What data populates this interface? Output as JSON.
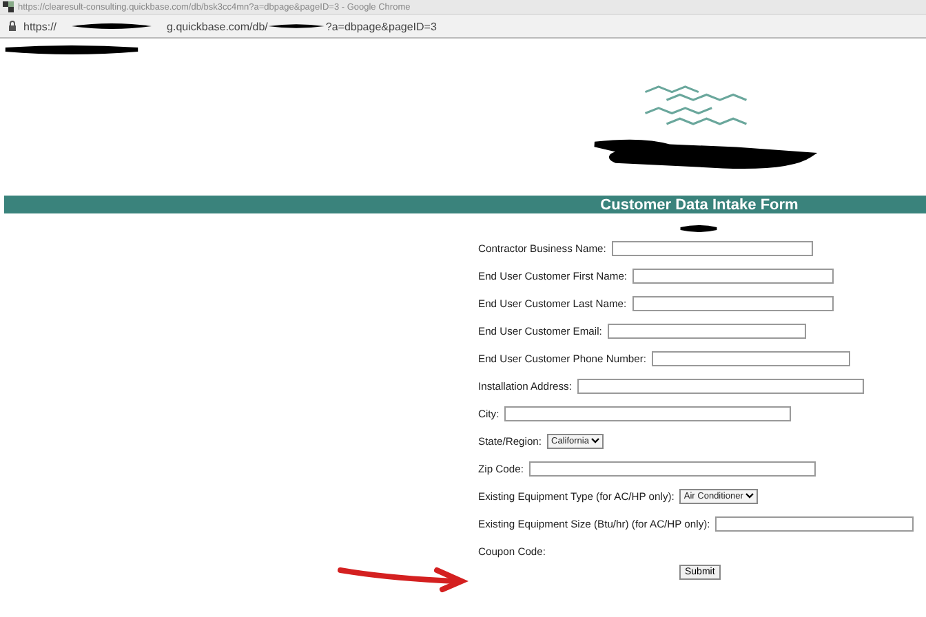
{
  "window": {
    "title": "https://clearesult-consulting.quickbase.com/db/bsk3cc4mn?a=dbpage&pageID=3 - Google Chrome"
  },
  "address_bar": {
    "parts": [
      "https://",
      "g.quickbase.com/db/",
      "?a=dbpage&pageID=3"
    ]
  },
  "form": {
    "title": "Customer Data Intake Form",
    "fields": [
      {
        "kind": "text",
        "label": "Contractor Business Name:"
      },
      {
        "kind": "text",
        "label": "End User Customer First Name:"
      },
      {
        "kind": "text",
        "label": "End User Customer Last Name:"
      },
      {
        "kind": "text",
        "label": "End User Customer Email:"
      },
      {
        "kind": "text",
        "label": "End User Customer Phone Number:"
      },
      {
        "kind": "text",
        "label": "Installation Address:"
      },
      {
        "kind": "text",
        "label": "City:"
      },
      {
        "kind": "select",
        "label": "State/Region:",
        "value": "California"
      },
      {
        "kind": "text",
        "label": "Zip Code:"
      },
      {
        "kind": "select",
        "label": "Existing Equipment Type (for AC/HP only):",
        "value": "Air Conditioner"
      },
      {
        "kind": "text",
        "label": "Existing Equipment Size (Btu/hr) (for AC/HP only):"
      },
      {
        "kind": "label",
        "label": "Coupon Code:"
      }
    ],
    "submit": "Submit"
  }
}
